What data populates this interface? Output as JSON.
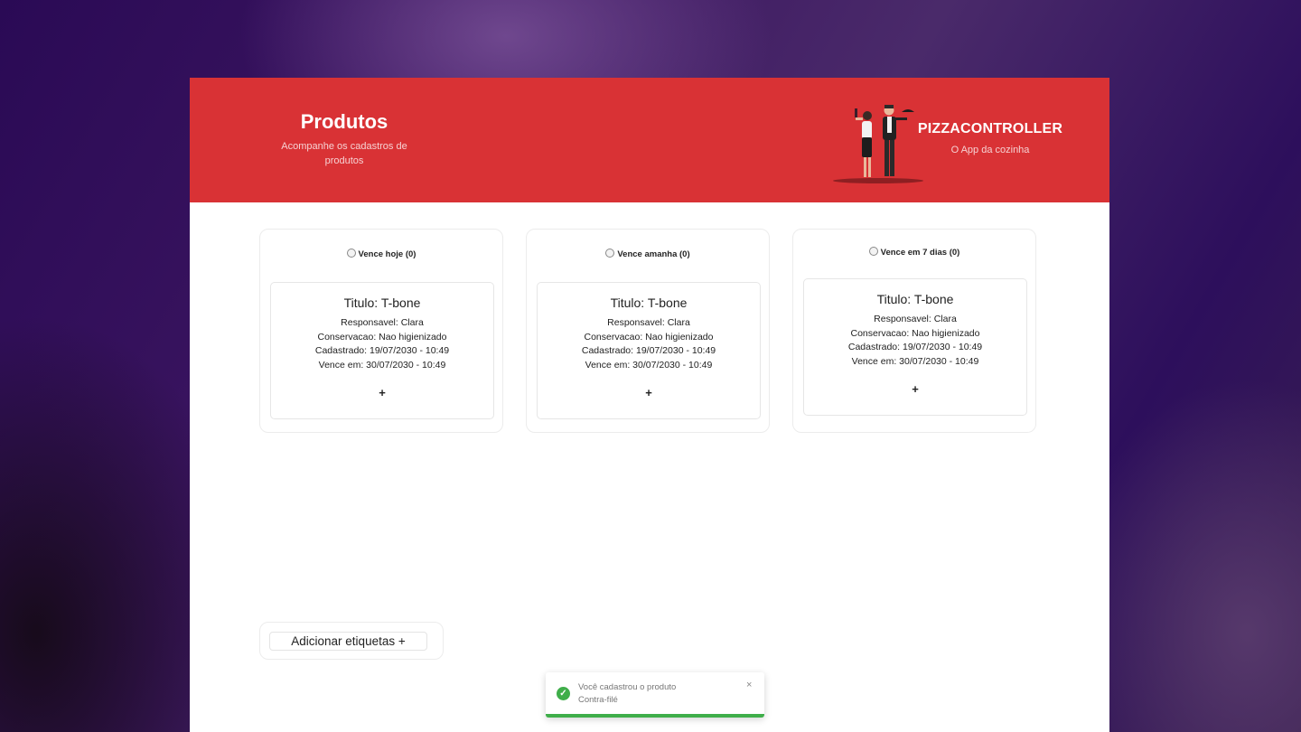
{
  "header": {
    "title": "Produtos",
    "subtitle": "Acompanhe os cadastros de produtos",
    "brand": "PIZZACONTROLLER",
    "tagline": "O App da cozinha",
    "color": "#d93235"
  },
  "columns": [
    {
      "title": "Vence hoje (0)",
      "card": {
        "title": "Titulo: T-bone",
        "responsavel": "Responsavel: Clara",
        "conservacao": "Conservacao: Nao higienizado",
        "cadastrado": "Cadastrado: 19/07/2030 - 10:49",
        "vence": "Vence em: 30/07/2030 - 10:49",
        "action": "+"
      }
    },
    {
      "title": "Vence amanha (0)",
      "card": {
        "title": "Titulo: T-bone",
        "responsavel": "Responsavel: Clara",
        "conservacao": "Conservacao: Nao higienizado",
        "cadastrado": "Cadastrado: 19/07/2030 - 10:49",
        "vence": "Vence em: 30/07/2030 - 10:49",
        "action": "+"
      }
    },
    {
      "title": "Vence em 7 dias (0)",
      "card": {
        "title": "Titulo: T-bone",
        "responsavel": "Responsavel: Clara",
        "conservacao": "Conservacao: Nao higienizado",
        "cadastrado": "Cadastrado: 19/07/2030 - 10:49",
        "vence": "Vence em: 30/07/2030 - 10:49",
        "action": "+"
      }
    }
  ],
  "add_button": {
    "label": "Adicionar etiquetas +"
  },
  "toast": {
    "line1": "Você cadastrou o produto",
    "line2": "Contra-filé",
    "close": "×",
    "icon": "check-circle-icon",
    "color": "#3fae4a"
  }
}
